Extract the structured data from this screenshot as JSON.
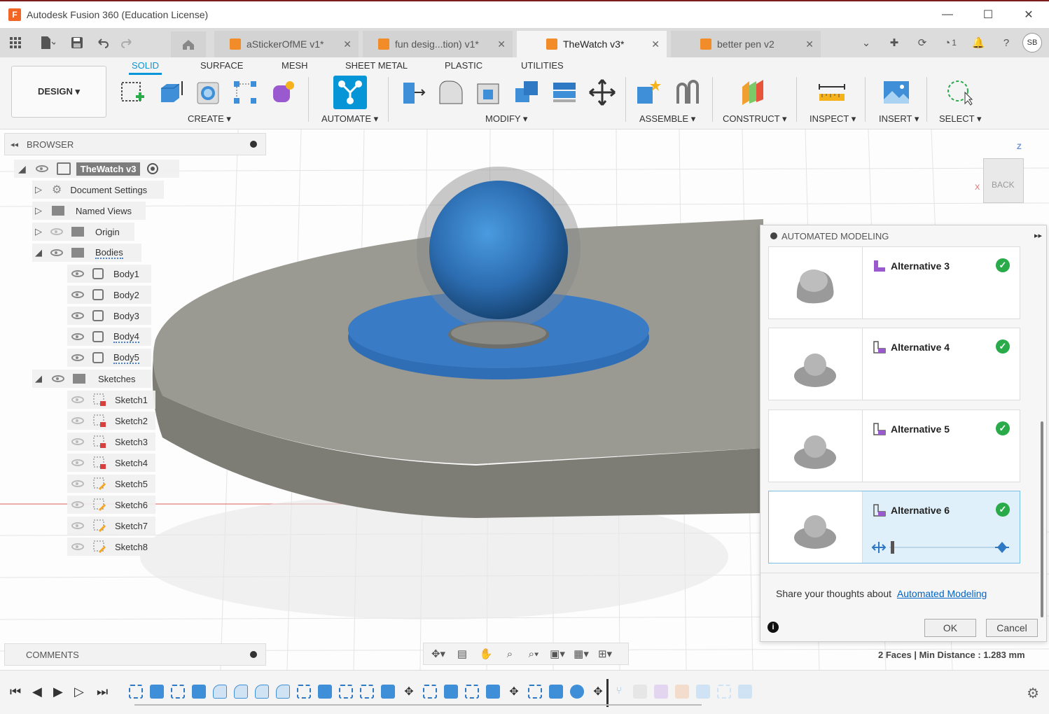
{
  "window": {
    "title": "Autodesk Fusion 360 (Education License)",
    "logo": "F",
    "minimize": "—",
    "maximize": "☐",
    "close": "✕"
  },
  "tabs": [
    {
      "label": "aStickerOfME v1*",
      "active": false
    },
    {
      "label": "fun desig...tion) v1*",
      "active": false
    },
    {
      "label": "TheWatch v3*",
      "active": true
    },
    {
      "label": "better pen v2",
      "active": false
    }
  ],
  "header_right": {
    "job_count": "1",
    "user_initials": "SB"
  },
  "toolbar": {
    "workspace": "DESIGN ▾",
    "workspace_tabs": [
      "SOLID",
      "SURFACE",
      "MESH",
      "SHEET METAL",
      "PLASTIC",
      "UTILITIES"
    ],
    "groups": [
      "CREATE ▾",
      "AUTOMATE ▾",
      "MODIFY ▾",
      "ASSEMBLE ▾",
      "CONSTRUCT ▾",
      "INSPECT ▾",
      "INSERT ▾",
      "SELECT ▾"
    ]
  },
  "browser": {
    "title": "BROWSER",
    "root": "TheWatch v3",
    "items": [
      {
        "label": "Document Settings"
      },
      {
        "label": "Named Views"
      },
      {
        "label": "Origin"
      },
      {
        "label": "Bodies"
      }
    ],
    "bodies": [
      "Body1",
      "Body2",
      "Body3",
      "Body4",
      "Body5"
    ],
    "sketches_label": "Sketches",
    "sketches": [
      "Sketch1",
      "Sketch2",
      "Sketch3",
      "Sketch4",
      "Sketch5",
      "Sketch6",
      "Sketch7",
      "Sketch8"
    ]
  },
  "viewcube": {
    "face": "BACK",
    "axis_z": "Z",
    "axis_x": "X"
  },
  "automated_modeling": {
    "title": "AUTOMATED MODELING",
    "alternatives": [
      {
        "label": "Alternative 3"
      },
      {
        "label": "Alternative 4"
      },
      {
        "label": "Alternative 5"
      },
      {
        "label": "Alternative 6",
        "selected": true
      }
    ],
    "feedback_text": "Share your thoughts about",
    "feedback_link": "Automated Modeling",
    "ok": "OK",
    "cancel": "Cancel",
    "check_mark": "✓",
    "info_mark": "i"
  },
  "comments": {
    "title": "COMMENTS"
  },
  "status": {
    "text": "2 Faces | Min Distance : 1.283 mm"
  },
  "colors": {
    "accent": "#0696d7",
    "sphere": "#2c6cb0",
    "disc": "#2f6db5",
    "plate": "#8d8d86",
    "check": "#2aab4a",
    "link": "#0064c8"
  }
}
